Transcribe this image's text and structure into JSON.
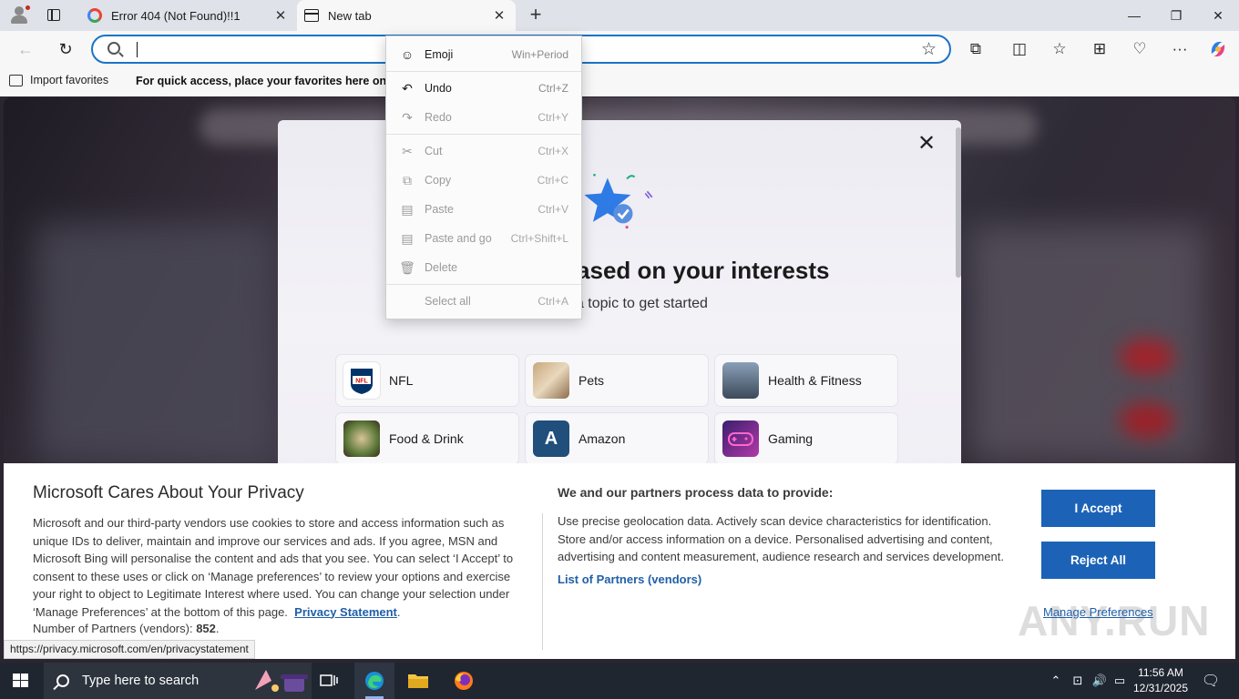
{
  "browser": {
    "tabs": [
      {
        "title": "Error 404 (Not Found)!!1"
      },
      {
        "title": "New tab"
      }
    ],
    "address": {
      "value": "",
      "placeholder": ""
    },
    "favorites": {
      "import_label": "Import favorites",
      "hint": "For quick access, place your favorites here on the favorites bar."
    }
  },
  "context_menu": {
    "items": [
      {
        "icon": "emoji-icon",
        "label": "Emoji",
        "shortcut": "Win+Period",
        "enabled": true
      },
      {
        "icon": "undo-icon",
        "label": "Undo",
        "shortcut": "Ctrl+Z",
        "enabled": true
      },
      {
        "icon": "redo-icon",
        "label": "Redo",
        "shortcut": "Ctrl+Y",
        "enabled": false
      },
      {
        "icon": "cut-icon",
        "label": "Cut",
        "shortcut": "Ctrl+X",
        "enabled": false
      },
      {
        "icon": "copy-icon",
        "label": "Copy",
        "shortcut": "Ctrl+C",
        "enabled": false
      },
      {
        "icon": "paste-icon",
        "label": "Paste",
        "shortcut": "Ctrl+V",
        "enabled": false
      },
      {
        "icon": "paste-and-go-icon",
        "label": "Paste and go",
        "shortcut": "Ctrl+Shift+L",
        "enabled": false
      },
      {
        "icon": "delete-icon",
        "label": "Delete",
        "shortcut": "",
        "enabled": false
      },
      {
        "icon": "",
        "label": "Select all",
        "shortcut": "Ctrl+A",
        "enabled": false
      }
    ]
  },
  "interests": {
    "title": "Personalized based on your interests",
    "subtitle": "Select a topic to get started",
    "topics": [
      {
        "label": "NFL",
        "icon": "nfl-logo"
      },
      {
        "label": "Pets",
        "icon": "pets-thumbnail"
      },
      {
        "label": "Health & Fitness",
        "icon": "fitness-thumbnail"
      },
      {
        "label": "Food & Drink",
        "icon": "food-thumbnail"
      },
      {
        "label": "Amazon",
        "icon": "amazon-thumbnail",
        "letter": "A"
      },
      {
        "label": "Gaming",
        "icon": "gaming-thumbnail"
      }
    ]
  },
  "privacy": {
    "title": "Microsoft Cares About Your Privacy",
    "body": "Microsoft and our third-party vendors use cookies to store and access information such as unique IDs to deliver, maintain and improve our services and ads. If you agree, MSN and Microsoft Bing will personalise the content and ads that you see. You can select ‘I Accept’ to consent to these uses or click on ‘Manage preferences’ to review your options and exercise your right to object to Legitimate Interest where used.  You can change your selection under ‘Manage Preferences’ at the bottom of this page.",
    "privacy_link": "Privacy Statement",
    "partners_count_label": "Number of Partners (vendors):",
    "partners_count": "852",
    "process_heading": "We and our partners process data to provide:",
    "process_body": "Use precise geolocation data. Actively scan device characteristics for identification. Store and/or access information on a device. Personalised advertising and content, advertising and content measurement, audience research and services development.",
    "partners_link": "List of Partners (vendors)",
    "accept": "I Accept",
    "reject": "Reject All",
    "manage": "Manage Preferences"
  },
  "status_url": "https://privacy.microsoft.com/en/privacystatement",
  "watermark": "ANY.RUN",
  "taskbar": {
    "search_placeholder": "Type here to search",
    "time": "11:56 AM",
    "date": "12/31/2025"
  },
  "colors": {
    "accent": "#1c63b8",
    "link": "#1f5fa8",
    "address_border": "#1a73c6",
    "taskbar": "#1f2630"
  }
}
